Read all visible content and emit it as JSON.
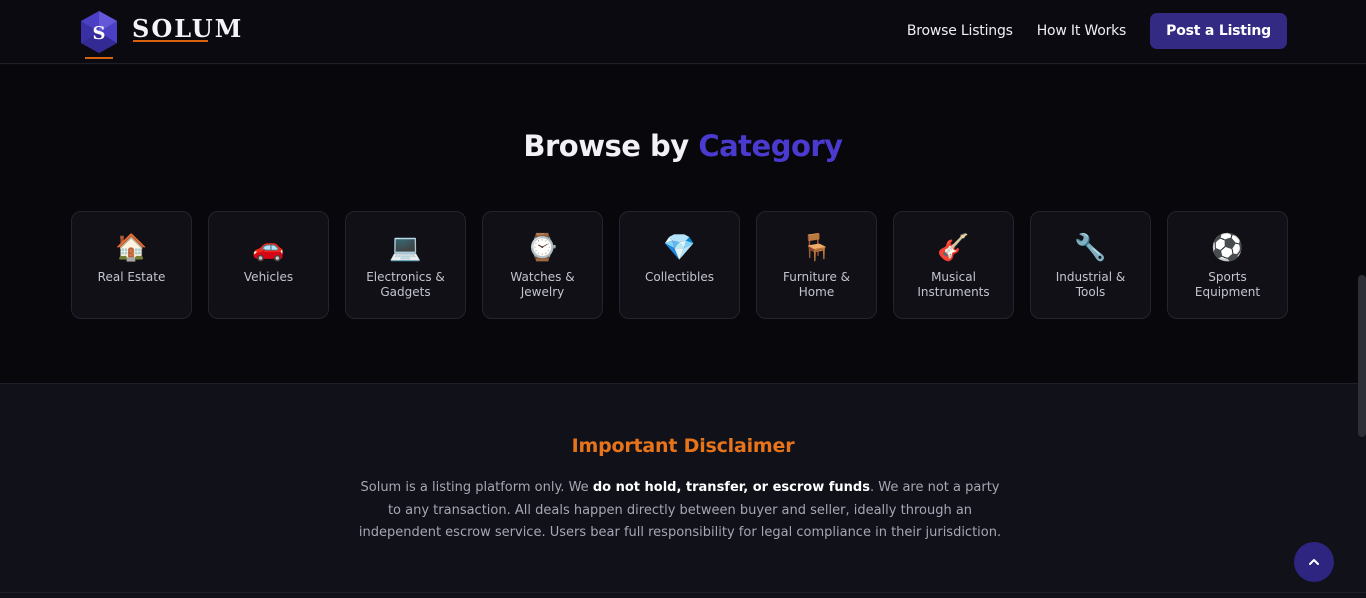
{
  "header": {
    "brand": "SOLUM",
    "badge_letter": "S",
    "nav": [
      "Browse Listings",
      "How It Works"
    ],
    "cta": "Post a Listing"
  },
  "categories": {
    "title_prefix": "Browse by",
    "title_accent": "Category",
    "items": [
      {
        "icon": "🏠",
        "label": "Real Estate"
      },
      {
        "icon": "🚗",
        "label": "Vehicles"
      },
      {
        "icon": "💻",
        "label": "Electronics & Gadgets"
      },
      {
        "icon": "⌚",
        "label": "Watches & Jewelry"
      },
      {
        "icon": "💎",
        "label": "Collectibles"
      },
      {
        "icon": "🪑",
        "label": "Furniture & Home"
      },
      {
        "icon": "🎸",
        "label": "Musical Instruments"
      },
      {
        "icon": "🔧",
        "label": "Industrial & Tools"
      },
      {
        "icon": "⚽",
        "label": "Sports Equipment"
      }
    ]
  },
  "disclaimer": {
    "title": "Important Disclaimer",
    "text_before": "Solum is a listing platform only. We ",
    "text_bold": "do not hold, transfer, or escrow funds",
    "text_after": ". We are not a party to any transaction. All deals happen directly between buyer and seller, ideally through an independent escrow service. Users bear full responsibility for legal compliance in their jurisdiction."
  },
  "scroll_top": {
    "icon": "chevron-up-icon",
    "glyph": "⌃"
  },
  "colors": {
    "accent": "#4a3ad0",
    "cta": "#332a84",
    "warning": "#e8741a"
  }
}
